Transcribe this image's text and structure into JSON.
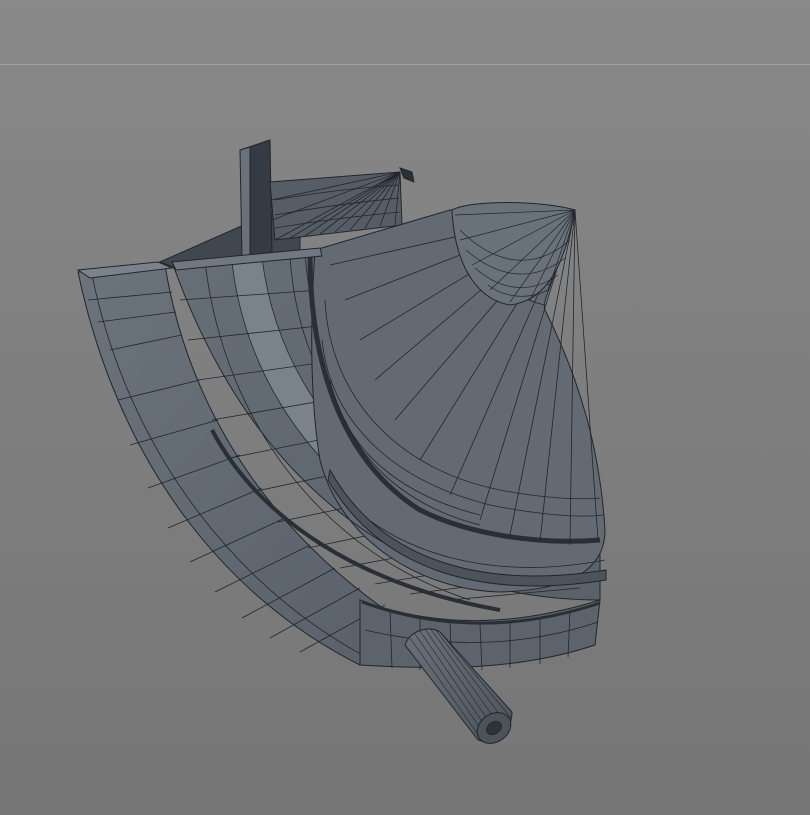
{
  "viewport": {
    "background_top": "#898989",
    "background_bottom": "#767676",
    "horizon_line_color": "#a3a3a3"
  },
  "model": {
    "shading": "wireframe-on-shaded",
    "surface_color": "#5f6670",
    "surface_dark": "#3f454d",
    "surface_light": "#727a84",
    "wire_color": "#22262b"
  }
}
